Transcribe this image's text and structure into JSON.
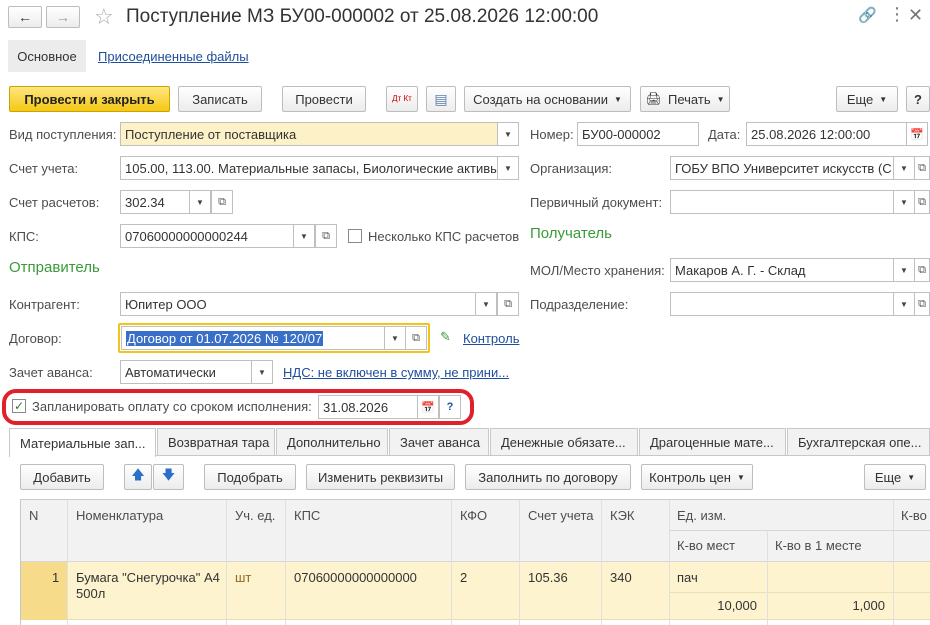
{
  "window": {
    "title": "Поступление МЗ БУ00-000002 от 25.08.2026 12:00:00",
    "nav_tabs": [
      "Основное",
      "Присоединенные файлы"
    ]
  },
  "toolbar": {
    "post_close": "Провести и закрыть",
    "save": "Записать",
    "post": "Провести",
    "dt_kt": "Дт Кт",
    "create_based": "Создать на основании",
    "print": "Печать",
    "more": "Еще",
    "help": "?"
  },
  "form": {
    "receipt_type": {
      "label": "Вид поступления:",
      "value": "Поступление от поставщика"
    },
    "account": {
      "label": "Счет учета:",
      "value": "105.00, 113.00. Материальные запасы, Биологические активы"
    },
    "settlement_account": {
      "label": "Счет расчетов:",
      "value": "302.34"
    },
    "kps": {
      "label": "КПС:",
      "value": "07060000000000244"
    },
    "several_kps": "Несколько КПС расчетов",
    "sender_header": "Отправитель",
    "counterparty": {
      "label": "Контрагент:",
      "value": "Юпитер ООО"
    },
    "contract": {
      "label": "Договор:",
      "value": "Договор от 01.07.2026 № 120/07"
    },
    "control_link": "Контроль",
    "advance_offset": {
      "label": "Зачет аванса:",
      "value": "Автоматически"
    },
    "vat_link": "НДС: не включен в сумму, не прини...",
    "schedule_payment": {
      "label": "Запланировать оплату со сроком исполнения:",
      "value": "31.08.2026",
      "checked": true,
      "help": "?"
    },
    "number": {
      "label": "Номер:",
      "value": "БУ00-000002"
    },
    "date": {
      "label": "Дата:",
      "value": "25.08.2026 12:00:00"
    },
    "organization": {
      "label": "Организация:",
      "value": "ГОБУ ВПО Университет искусств (С"
    },
    "primary_doc": {
      "label": "Первичный документ:",
      "value": ""
    },
    "recipient_header": "Получатель",
    "mol": {
      "label": "МОЛ/Место хранения:",
      "value": "Макаров А. Г. - Склад"
    },
    "division": {
      "label": "Подразделение:",
      "value": ""
    }
  },
  "tabs": [
    "Материальные зап...",
    "Возвратная тара",
    "Дополнительно",
    "Зачет аванса",
    "Денежные обязате...",
    "Драгоценные мате...",
    "Бухгалтерская опе..."
  ],
  "table_toolbar": {
    "add": "Добавить",
    "pick": "Подобрать",
    "change_details": "Изменить реквизиты",
    "fill_contract": "Заполнить по договору",
    "price_control": "Контроль цен",
    "more": "Еще"
  },
  "table": {
    "headers": {
      "n": "N",
      "nomenclature": "Номенклатура",
      "unit": "Уч. ед.",
      "kps": "КПС",
      "kfo": "КФО",
      "account": "Счет учета",
      "kek": "КЭК",
      "unit_meas": "Ед. изм.",
      "places": "К-во мест",
      "qty_in_place": "К-во в 1 месте",
      "qty": "К-во"
    },
    "rows": [
      {
        "n": "1",
        "nomenclature": "Бумага \"Снегурочка\" А4 500л",
        "unit": "шт",
        "kps": "07060000000000000",
        "kfo": "2",
        "account": "105.36",
        "kek": "340",
        "unit_meas": "пач",
        "places": "10,000",
        "qty_in_place": "1,000"
      }
    ]
  },
  "colors": {
    "primary_button": "#f5c814",
    "highlight_field": "#fdf1c7",
    "section_header": "#3a9a3a",
    "link": "#1f4e9c",
    "row_selected": "#fdf3cf",
    "annotation_red": "#e0202a"
  }
}
